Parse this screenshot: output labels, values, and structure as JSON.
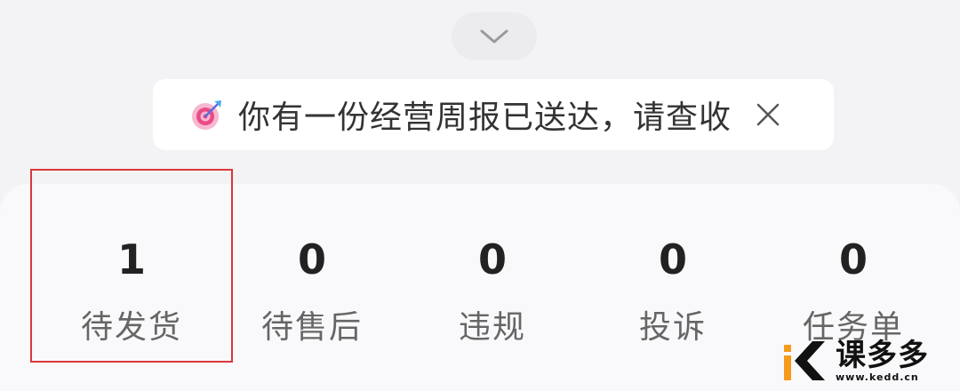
{
  "notice": {
    "text": "你有一份经营周报已送达，请查收",
    "icon": "target-icon",
    "close_icon": "close-icon"
  },
  "collapse": {
    "icon": "chevron-down-icon"
  },
  "stats": [
    {
      "value": "1",
      "label": "待发货"
    },
    {
      "value": "0",
      "label": "待售后"
    },
    {
      "value": "0",
      "label": "违规"
    },
    {
      "value": "0",
      "label": "投诉"
    },
    {
      "value": "0",
      "label": "任务单"
    }
  ],
  "watermark": {
    "brand": "课多多",
    "url": "www.kedd.cn"
  },
  "colors": {
    "background": "#f3f3f5",
    "card": "#f9f9fb",
    "highlight": "#d9383a",
    "text_primary": "#222222",
    "text_secondary": "#666666",
    "accent_orange": "#f59a1b"
  }
}
